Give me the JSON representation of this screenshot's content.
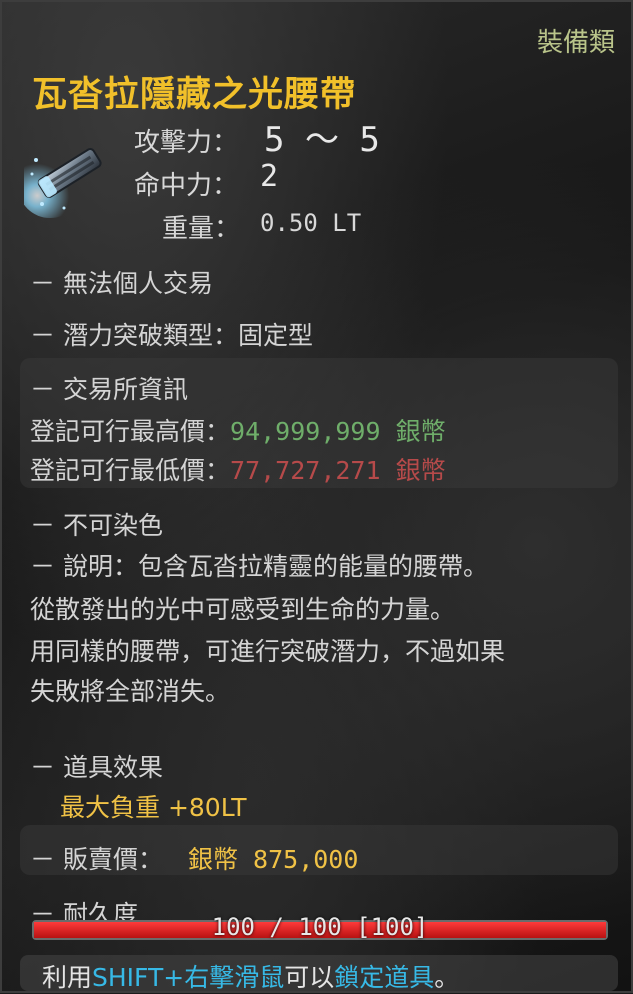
{
  "header": {
    "category": "裝備類",
    "item_name": "瓦沓拉隱藏之光腰帶"
  },
  "icon": {
    "name": "belt-icon",
    "glow_color": "#8fdcff"
  },
  "stats": {
    "attack_label": "攻擊力：",
    "attack_value": "5 ～ 5",
    "accuracy_label": "命中力：",
    "accuracy_value": "2",
    "weight_label": "重量：",
    "weight_value": "0.50 LT"
  },
  "lines": {
    "no_trade": "－ 無法個人交易",
    "enhance_type": "－ 潛力突破類型：固定型"
  },
  "market": {
    "title": "－ 交易所資訊",
    "max_label": "登記可行最高價：",
    "max_value": "94,999,999 銀幣",
    "min_label": "登記可行最低價：",
    "min_value": "77,727,271 銀幣",
    "max_color": "#6fae6a",
    "min_color": "#b64a4a"
  },
  "description": {
    "no_dye": "－ 不可染色",
    "line1": "－ 說明：包含瓦沓拉精靈的能量的腰帶。",
    "line2": "從散發出的光中可感受到生命的力量。",
    "line3": "用同樣的腰帶，可進行突破潛力，不過如果",
    "line4": "失敗將全部消失。"
  },
  "effect": {
    "title": "－ 道具效果",
    "value": "最大負重 +80LT"
  },
  "sell": {
    "label": "－ 販賣價：",
    "value": "銀幣 875,000"
  },
  "durability": {
    "title": "－ 耐久度",
    "text": "100 / 100 [100]",
    "current": 100,
    "max": 100,
    "bar_color": "#e02020"
  },
  "hint": {
    "prefix": "利用",
    "key": "SHIFT+右擊滑鼠",
    "middle": "可以",
    "action": "鎖定道具",
    "suffix": "。"
  }
}
